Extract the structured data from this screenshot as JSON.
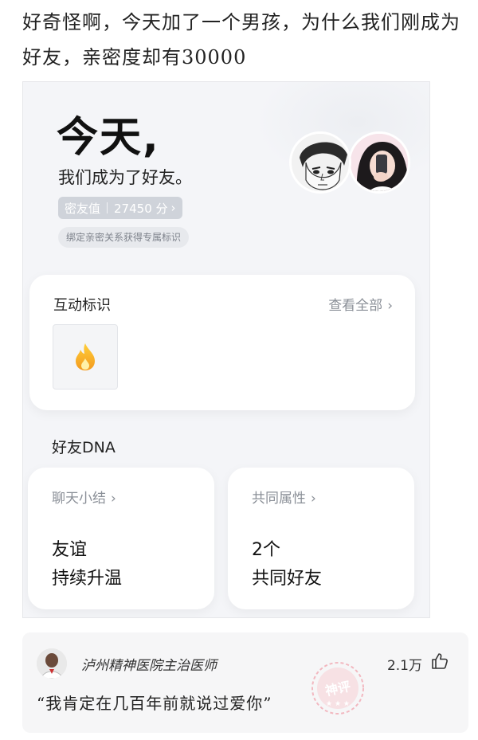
{
  "post": {
    "text": "好奇怪啊，今天加了一个男孩，为什么我们刚成为好友，亲密度却有30000"
  },
  "screenshot": {
    "headline": "今天,",
    "subline": "我们成为了好友。",
    "score_label": "密友值",
    "score_value": "27450 分",
    "bind_hint": "绑定亲密关系获得专属标识",
    "interaction_card": {
      "title": "互动标识",
      "see_all": "查看全部",
      "badge_icon": "flame-icon"
    },
    "dna_heading": "好友DNA",
    "chat_summary": {
      "title": "聊天小结",
      "line1": "友谊",
      "line2": "持续升温"
    },
    "common_attrs": {
      "title": "共同属性",
      "line1": "2个",
      "line2": "共同好友"
    },
    "accent_flame": "#f5a623"
  },
  "comment": {
    "author": "泸州精神医院主治医师",
    "likes": "2.1万",
    "text": "“我肯定在几百年前就说过爱你”",
    "stamp_text": "神评"
  }
}
